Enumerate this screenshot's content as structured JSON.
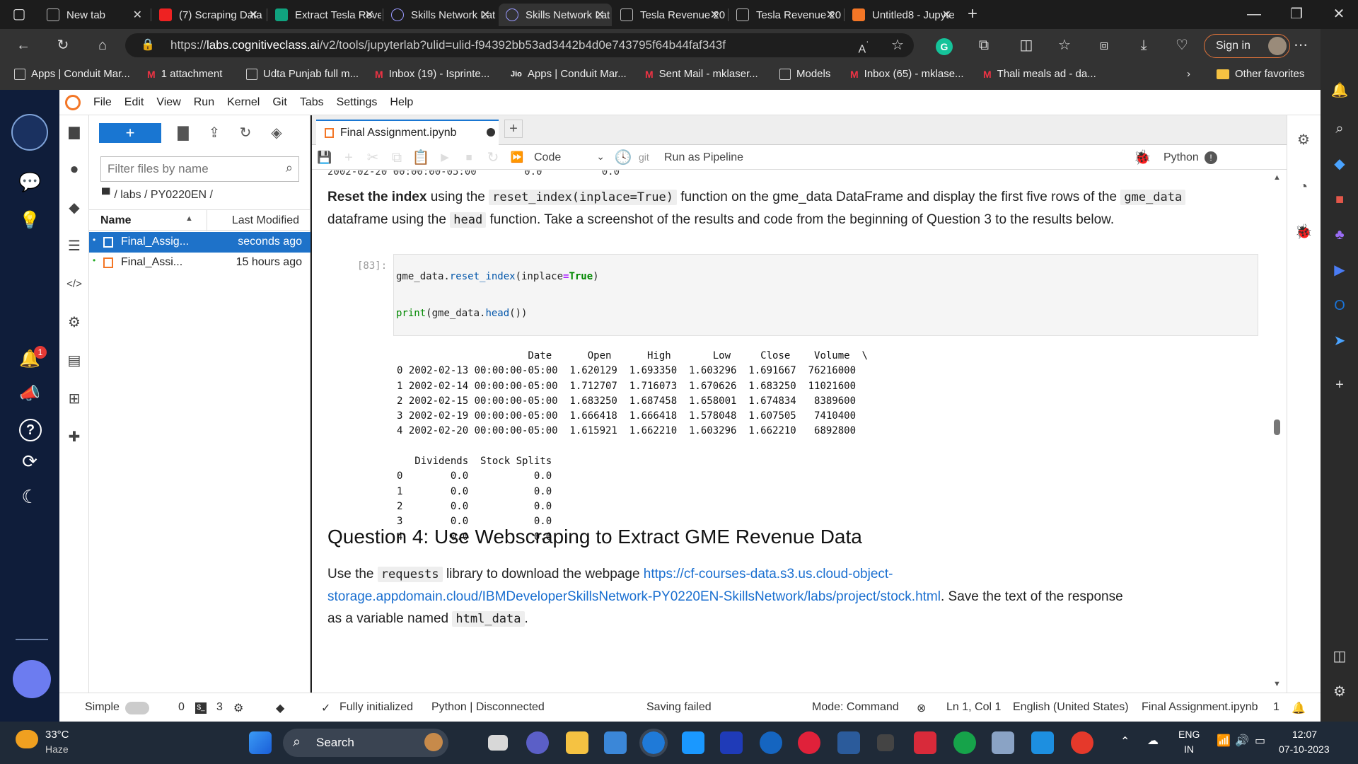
{
  "browser": {
    "tabs": [
      {
        "label": "New tab"
      },
      {
        "label": "(7) Scraping Data"
      },
      {
        "label": "Extract Tesla Reve"
      },
      {
        "label": "Skills Network Lat"
      },
      {
        "label": "Skills Network Lat"
      },
      {
        "label": "Tesla Revenue 20"
      },
      {
        "label": "Tesla Revenue 20"
      },
      {
        "label": "Untitled8 - Jupyte"
      }
    ],
    "url_prefix": "https://",
    "url_host": "labs.cognitiveclass.ai",
    "url_path": "/v2/tools/jupyterlab?ulid=ulid-f94392bb53ad3442b4d0e743795f64b44faf343f",
    "sign_in": "Sign in",
    "bookmarks": [
      {
        "label": "Apps | Conduit Mar..."
      },
      {
        "label": "1 attachment"
      },
      {
        "label": "Udta Punjab full m..."
      },
      {
        "label": "Inbox (19) - Isprinte..."
      },
      {
        "label": "Apps | Conduit Mar..."
      },
      {
        "label": "Sent Mail - mklaser..."
      },
      {
        "label": "Models"
      },
      {
        "label": "Inbox (65) - mklase..."
      },
      {
        "label": "Thali meals ad - da..."
      }
    ],
    "other_favorites": "Other favorites"
  },
  "jupyter": {
    "menu": [
      "File",
      "Edit",
      "View",
      "Run",
      "Kernel",
      "Git",
      "Tabs",
      "Settings",
      "Help"
    ],
    "filter_placeholder": "Filter files by name",
    "breadcrumb": "/ labs / PY0220EN /",
    "file_headers": {
      "name": "Name",
      "modified": "Last Modified"
    },
    "files": [
      {
        "name": "Final_Assig...",
        "modified": "seconds ago"
      },
      {
        "name": "Final_Assi...",
        "modified": "15 hours ago"
      }
    ],
    "notebook_tab": "Final Assignment.ipynb",
    "cell_type": "Code",
    "git_label": "git",
    "run_pipeline": "Run as Pipeline",
    "kernel": "Python",
    "partial_top_line": "2002-02-20 00:00:00-05:00        0.0          0.0",
    "markdown1_bold": "Reset the index",
    "markdown1_a": "using the",
    "markdown1_code1": "reset_index(inplace=True)",
    "markdown1_b": "function on the gme_data DataFrame and display the first five rows of the",
    "markdown1_code2": "gme_data",
    "markdown1_c": "dataframe using the",
    "markdown1_code3": "head",
    "markdown1_d": "function. Take a screenshot of the results and code from the beginning of Question 3 to the results below.",
    "cell_prompt": "[83]:",
    "code_line1_obj": "gme_data.",
    "code_line1_fn": "reset_index",
    "code_line1_arg": "(inplace",
    "code_line1_eq": "=",
    "code_line1_val": "True",
    "code_line1_end": ")",
    "code_line2_print": "print",
    "code_line2_obj": "(gme_data.",
    "code_line2_fn": "head",
    "code_line2_end": "())",
    "output": "                      Date      Open      High       Low     Close    Volume  \\\n0 2002-02-13 00:00:00-05:00  1.620129  1.693350  1.603296  1.691667  76216000\n1 2002-02-14 00:00:00-05:00  1.712707  1.716073  1.670626  1.683250  11021600\n2 2002-02-15 00:00:00-05:00  1.683250  1.687458  1.658001  1.674834   8389600\n3 2002-02-19 00:00:00-05:00  1.666418  1.666418  1.578048  1.607505   7410400\n4 2002-02-20 00:00:00-05:00  1.615921  1.662210  1.603296  1.662210   6892800\n\n   Dividends  Stock Splits\n0        0.0           0.0\n1        0.0           0.0\n2        0.0           0.0\n3        0.0           0.0\n4        0.0           0.0",
    "question4_heading": "Question 4: Use Webscraping to Extract GME Revenue Data",
    "md2_a": "Use the",
    "md2_code": "requests",
    "md2_b": "library to download the webpage",
    "md2_link1": "https://cf-courses-data.s3.us.cloud-object-",
    "md2_link2": "storage.appdomain.cloud/IBMDeveloperSkillsNetwork-PY0220EN-SkillsNetwork/labs/project/stock.html",
    "md2_c": ". Save the text of the response",
    "md2_d": "as a variable named",
    "md2_code2": "html_data",
    "md2_e": "."
  },
  "status": {
    "mode_simple": "Simple",
    "num0": "0",
    "terminal_num": "3",
    "fully_initialized": "Fully initialized",
    "kernel_status": "Python | Disconnected",
    "saving": "Saving failed",
    "mode": "Mode: Command",
    "cursor": "Ln 1, Col 1",
    "language": "English (United States)",
    "file": "Final Assignment.ipynb",
    "count": "1"
  },
  "taskbar": {
    "temp": "33°C",
    "weather": "Haze",
    "search": "Search",
    "lang1": "ENG",
    "lang2": "IN",
    "time": "12:07",
    "date": "07-10-2023"
  },
  "notification_badge": "1"
}
